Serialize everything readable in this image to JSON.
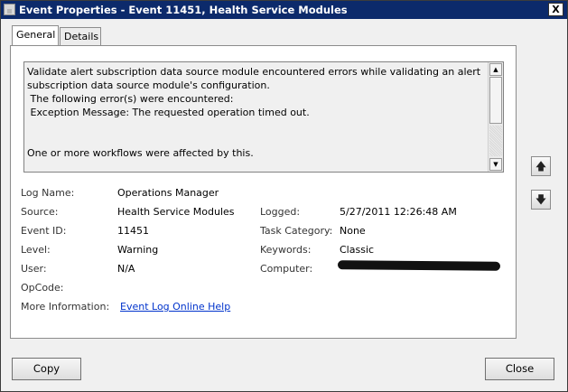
{
  "window": {
    "title": "Event Properties - Event 11451, Health Service Modules",
    "close_glyph": "X"
  },
  "tabs": [
    {
      "label": "General",
      "active": true
    },
    {
      "label": "Details",
      "active": false
    }
  ],
  "description": "Validate alert subscription data source module encountered errors while validating an alert\nsubscription data source module's configuration.\n The following error(s) were encountered:\n Exception Message: The requested operation timed out.\n\n\nOne or more workflows were affected by this.",
  "fields": {
    "log_name": {
      "label": "Log Name:",
      "value": "Operations Manager"
    },
    "source": {
      "label": "Source:",
      "value": "Health Service Modules"
    },
    "event_id": {
      "label": "Event ID:",
      "value": "11451"
    },
    "level": {
      "label": "Level:",
      "value": "Warning"
    },
    "user": {
      "label": "User:",
      "value": "N/A"
    },
    "opcode": {
      "label": "OpCode:",
      "value": ""
    },
    "more_info": {
      "label": "More Information:",
      "value": "Event Log Online Help"
    },
    "logged": {
      "label": "Logged:",
      "value": "5/27/2011 12:26:48 AM"
    },
    "task_category": {
      "label": "Task Category:",
      "value": "None"
    },
    "keywords": {
      "label": "Keywords:",
      "value": "Classic"
    },
    "computer": {
      "label": "Computer:",
      "value": ""
    }
  },
  "icons": {
    "up_arrow": "🡅",
    "down_arrow": "🡇",
    "scroll_up": "▲",
    "scroll_down": "▼"
  },
  "buttons": {
    "copy": "Copy",
    "close": "Close"
  }
}
